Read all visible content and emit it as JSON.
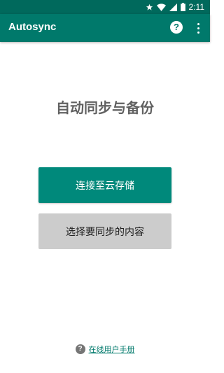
{
  "status_bar": {
    "time": "2:11",
    "icons": [
      "star-icon",
      "wifi-icon",
      "signal-icon",
      "battery-icon"
    ]
  },
  "app_bar": {
    "title": "Autosync",
    "help_icon_glyph": "?",
    "background_color": "#00796b"
  },
  "main": {
    "headline": "自动同步与备份",
    "connect_button_label": "连接至云存储",
    "select_button_label": "选择要同步的内容"
  },
  "footer": {
    "help_glyph": "?",
    "manual_link_label": "在线用户手册"
  },
  "colors": {
    "accent": "#00897b",
    "status_bar": "#00695c",
    "secondary_button": "#cccccc"
  }
}
